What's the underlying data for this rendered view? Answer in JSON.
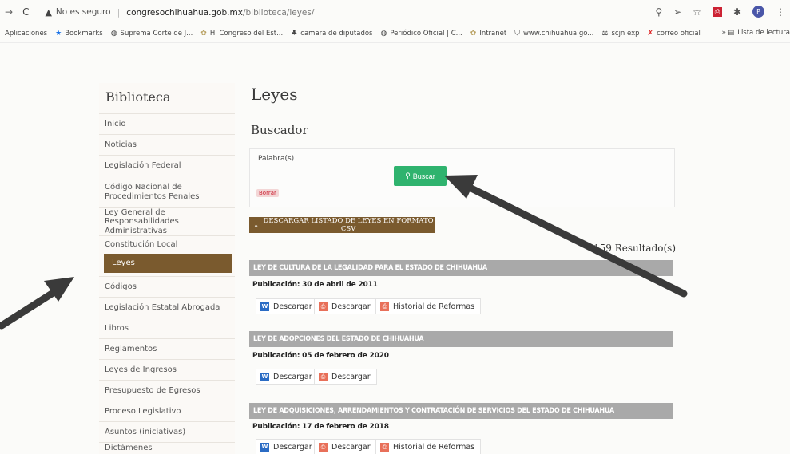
{
  "browser": {
    "security_text": "No es seguro",
    "url_host": "congresochihuahua.gob.mx",
    "url_path": "/biblioteca/leyes/",
    "bookmarks": [
      {
        "label": "Aplicaciones",
        "icon": "apps-icon"
      },
      {
        "label": "Bookmarks",
        "icon": "star-icon"
      },
      {
        "label": "Suprema Corte de J...",
        "icon": "globe-icon"
      },
      {
        "label": "H. Congreso del Est...",
        "icon": "congress-icon"
      },
      {
        "label": "camara de diputados",
        "icon": "camara-icon"
      },
      {
        "label": "Periódico Oficial | C...",
        "icon": "globe-icon"
      },
      {
        "label": "Intranet",
        "icon": "congress-icon"
      },
      {
        "label": "www.chihuahua.go...",
        "icon": "shield-icon"
      },
      {
        "label": "scjn exp",
        "icon": "scjn-icon"
      },
      {
        "label": "correo oficial",
        "icon": "x-icon"
      }
    ],
    "more": "»",
    "reading_list": "Lista de lectura"
  },
  "sidebar": {
    "title": "Biblioteca",
    "items": [
      "Inicio",
      "Noticias",
      "Legislación Federal",
      "Código Nacional de Procedimientos Penales",
      "Ley General de Responsabilidades Administrativas",
      "Constitución Local",
      "Leyes",
      "Códigos",
      "Legislación Estatal Abrogada",
      "Libros",
      "Reglamentos",
      "Leyes de Ingresos",
      "Presupuesto de Egresos",
      "Proceso Legislativo",
      "Asuntos (iniciativas)",
      "Dictámenes"
    ],
    "active_index": 6
  },
  "main": {
    "title": "Leyes",
    "search_title": "Buscador",
    "keyword_label": "Palabra(s)",
    "keyword_value": "",
    "search_button": "Buscar",
    "clear_button": "Borrar",
    "csv_button": "DESCARGAR LISTADO DE LEYES EN FORMATO CSV",
    "results": "159 Resultado(s)",
    "laws": [
      {
        "title": "LEY DE CULTURA DE LA LEGALIDAD PARA EL ESTADO DE CHIHUAHUA",
        "publication": "Publicación: 30 de abril de 2011",
        "buttons": [
          "Descargar",
          "Descargar",
          "Historial de Reformas"
        ]
      },
      {
        "title": "LEY DE ADOPCIONES DEL ESTADO DE CHIHUAHUA",
        "publication": "Publicación: 05 de febrero de 2020",
        "buttons": [
          "Descargar",
          "Descargar"
        ]
      },
      {
        "title": "LEY DE ADQUISICIONES, ARRENDAMIENTOS Y CONTRATACIÓN DE SERVICIOS DEL ESTADO DE CHIHUAHUA",
        "publication": "Publicación: 17 de febrero de 2018",
        "buttons": [
          "Descargar",
          "Descargar",
          "Historial de Reformas"
        ]
      }
    ]
  },
  "colors": {
    "active_item": "#7a5a2e",
    "search_button": "#2fb36e",
    "law_header": "#a9a9a9",
    "annotation_arrow": "#3a3a3a"
  }
}
